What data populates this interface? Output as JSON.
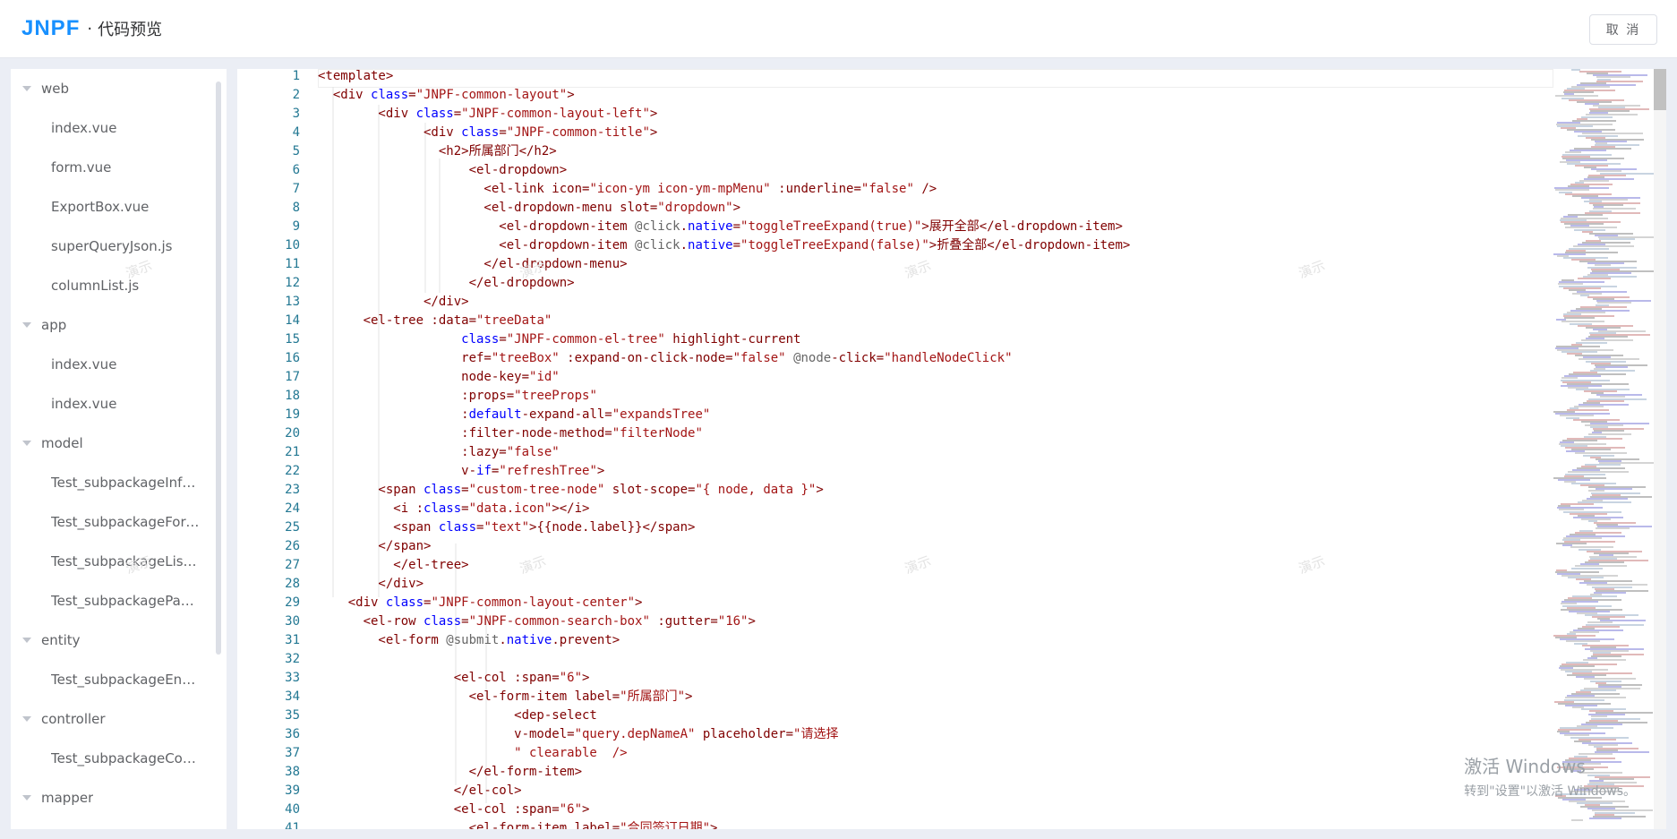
{
  "header": {
    "logo": "JNPF",
    "separator": "·",
    "title": "代码预览",
    "cancel_label": "取 消"
  },
  "sidebar": {
    "nodes": [
      {
        "type": "folder",
        "label": "web"
      },
      {
        "type": "file",
        "label": "index.vue"
      },
      {
        "type": "file",
        "label": "form.vue"
      },
      {
        "type": "file",
        "label": "ExportBox.vue"
      },
      {
        "type": "file",
        "label": "superQueryJson.js"
      },
      {
        "type": "file",
        "label": "columnList.js"
      },
      {
        "type": "folder",
        "label": "app"
      },
      {
        "type": "file",
        "label": "index.vue"
      },
      {
        "type": "file",
        "label": "index.vue"
      },
      {
        "type": "folder",
        "label": "model"
      },
      {
        "type": "file",
        "label": "Test_subpackageInfoVO.java"
      },
      {
        "type": "file",
        "label": "Test_subpackageForm.java"
      },
      {
        "type": "file",
        "label": "Test_subpackageListVO.java"
      },
      {
        "type": "file",
        "label": "Test_subpackagePagination.java"
      },
      {
        "type": "folder",
        "label": "entity"
      },
      {
        "type": "file",
        "label": "Test_subpackageEntity.java"
      },
      {
        "type": "folder",
        "label": "controller"
      },
      {
        "type": "file",
        "label": "Test_subpackageController.java"
      },
      {
        "type": "folder",
        "label": "mapper"
      }
    ]
  },
  "code": {
    "lines": [
      [
        [
          "t",
          "<template>"
        ]
      ],
      [
        [
          "t",
          "  <div "
        ],
        [
          "k",
          "class"
        ],
        [
          "t",
          "="
        ],
        [
          "s",
          "\"JNPF-common-layout\""
        ],
        [
          "t",
          ">"
        ]
      ],
      [
        [
          "t",
          "        <div "
        ],
        [
          "k",
          "class"
        ],
        [
          "t",
          "="
        ],
        [
          "s",
          "\"JNPF-common-layout-left\""
        ],
        [
          "t",
          ">"
        ]
      ],
      [
        [
          "t",
          "              <div "
        ],
        [
          "k",
          "class"
        ],
        [
          "t",
          "="
        ],
        [
          "s",
          "\"JNPF-common-title\""
        ],
        [
          "t",
          ">"
        ]
      ],
      [
        [
          "t",
          "                <h2>所属部门</h2>"
        ]
      ],
      [
        [
          "t",
          "                    <el-dropdown>"
        ]
      ],
      [
        [
          "t",
          "                      <el-link icon="
        ],
        [
          "s",
          "\"icon-ym icon-ym-mpMenu\""
        ],
        [
          "t",
          " :underline="
        ],
        [
          "s",
          "\"false\""
        ],
        [
          "t",
          " />"
        ]
      ],
      [
        [
          "t",
          "                      <el-dropdown-menu slot="
        ],
        [
          "s",
          "\"dropdown\""
        ],
        [
          "t",
          ">"
        ]
      ],
      [
        [
          "t",
          "                        <el-dropdown-item "
        ],
        [
          "e",
          "@click"
        ],
        [
          "t",
          "."
        ],
        [
          "k",
          "native"
        ],
        [
          "t",
          "="
        ],
        [
          "s",
          "\"toggleTreeExpand(true)\""
        ],
        [
          "t",
          ">展开全部</el-dropdown-item>"
        ]
      ],
      [
        [
          "t",
          "                        <el-dropdown-item "
        ],
        [
          "e",
          "@click"
        ],
        [
          "t",
          "."
        ],
        [
          "k",
          "native"
        ],
        [
          "t",
          "="
        ],
        [
          "s",
          "\"toggleTreeExpand(false)\""
        ],
        [
          "t",
          ">折叠全部</el-dropdown-item>"
        ]
      ],
      [
        [
          "t",
          "                      </el-dropdown-menu>"
        ]
      ],
      [
        [
          "t",
          "                    </el-dropdown>"
        ]
      ],
      [
        [
          "t",
          "              </div>"
        ]
      ],
      [
        [
          "t",
          "      <el-tree :data="
        ],
        [
          "s",
          "\"treeData\""
        ]
      ],
      [
        [
          "t",
          "                   "
        ],
        [
          "k",
          "class"
        ],
        [
          "t",
          "="
        ],
        [
          "s",
          "\"JNPF-common-el-tree\""
        ],
        [
          "t",
          " highlight-current"
        ]
      ],
      [
        [
          "t",
          "                   ref="
        ],
        [
          "s",
          "\"treeBox\""
        ],
        [
          "t",
          " :expand-on-click-node="
        ],
        [
          "s",
          "\"false\""
        ],
        [
          "t",
          " "
        ],
        [
          "e",
          "@node"
        ],
        [
          "t",
          "-click="
        ],
        [
          "s",
          "\"handleNodeClick\""
        ]
      ],
      [
        [
          "t",
          "                   node-key="
        ],
        [
          "s",
          "\"id\""
        ]
      ],
      [
        [
          "t",
          "                   :props="
        ],
        [
          "s",
          "\"treeProps\""
        ]
      ],
      [
        [
          "t",
          "                   :"
        ],
        [
          "k",
          "default"
        ],
        [
          "t",
          "-expand-all="
        ],
        [
          "s",
          "\"expandsTree\""
        ]
      ],
      [
        [
          "t",
          "                   :filter-node-method="
        ],
        [
          "s",
          "\"filterNode\""
        ]
      ],
      [
        [
          "t",
          "                   :lazy="
        ],
        [
          "s",
          "\"false\""
        ]
      ],
      [
        [
          "t",
          "                   v-"
        ],
        [
          "k",
          "if"
        ],
        [
          "t",
          "="
        ],
        [
          "s",
          "\"refreshTree\""
        ],
        [
          "t",
          ">"
        ]
      ],
      [
        [
          "t",
          "        <span "
        ],
        [
          "k",
          "class"
        ],
        [
          "t",
          "="
        ],
        [
          "s",
          "\"custom-tree-node\""
        ],
        [
          "t",
          " slot-scope="
        ],
        [
          "s",
          "\"{ node, data }\""
        ],
        [
          "t",
          ">"
        ]
      ],
      [
        [
          "t",
          "          <i :"
        ],
        [
          "k",
          "class"
        ],
        [
          "t",
          "="
        ],
        [
          "s",
          "\"data.icon\""
        ],
        [
          "t",
          "></i>"
        ]
      ],
      [
        [
          "t",
          "          <span "
        ],
        [
          "k",
          "class"
        ],
        [
          "t",
          "="
        ],
        [
          "s",
          "\"text\""
        ],
        [
          "t",
          ">{{node.label}}</span>"
        ]
      ],
      [
        [
          "t",
          "        </span>"
        ]
      ],
      [
        [
          "t",
          "          </el-tree>"
        ]
      ],
      [
        [
          "t",
          "        </div>"
        ]
      ],
      [
        [
          "t",
          "    <div "
        ],
        [
          "k",
          "class"
        ],
        [
          "t",
          "="
        ],
        [
          "s",
          "\"JNPF-common-layout-center\""
        ],
        [
          "t",
          ">"
        ]
      ],
      [
        [
          "t",
          "      <el-row "
        ],
        [
          "k",
          "class"
        ],
        [
          "t",
          "="
        ],
        [
          "s",
          "\"JNPF-common-search-box\""
        ],
        [
          "t",
          " :gutter="
        ],
        [
          "s",
          "\"16\""
        ],
        [
          "t",
          ">"
        ]
      ],
      [
        [
          "t",
          "        <el-form "
        ],
        [
          "e",
          "@submit"
        ],
        [
          "t",
          "."
        ],
        [
          "k",
          "native"
        ],
        [
          "t",
          ".prevent>"
        ]
      ],
      [
        [
          "t",
          ""
        ]
      ],
      [
        [
          "t",
          "                  <el-col :span="
        ],
        [
          "s",
          "\"6\""
        ],
        [
          "t",
          ">"
        ]
      ],
      [
        [
          "t",
          "                    <el-form-item label="
        ],
        [
          "s",
          "\"所属部门\""
        ],
        [
          "t",
          ">"
        ]
      ],
      [
        [
          "t",
          "                          <dep-select"
        ]
      ],
      [
        [
          "t",
          "                          v-model="
        ],
        [
          "s",
          "\"query.depNameA\""
        ],
        [
          "t",
          " placeholder="
        ],
        [
          "s",
          "\"请选择"
        ]
      ],
      [
        [
          "s",
          "                          \" clearable  />"
        ]
      ],
      [
        [
          "t",
          "                    </el-form-item>"
        ]
      ],
      [
        [
          "t",
          "                  </el-col>"
        ]
      ],
      [
        [
          "t",
          "                  <el-col :span="
        ],
        [
          "s",
          "\"6\""
        ],
        [
          "t",
          ">"
        ]
      ],
      [
        [
          "t",
          "                    <el-form-item label="
        ],
        [
          "s",
          "\"合同签订日期\""
        ],
        [
          "t",
          ">"
        ]
      ]
    ]
  },
  "watermark_text": "演示",
  "activation": {
    "line1": "激活 Windows",
    "line2": "转到\"设置\"以激活 Windows。"
  }
}
